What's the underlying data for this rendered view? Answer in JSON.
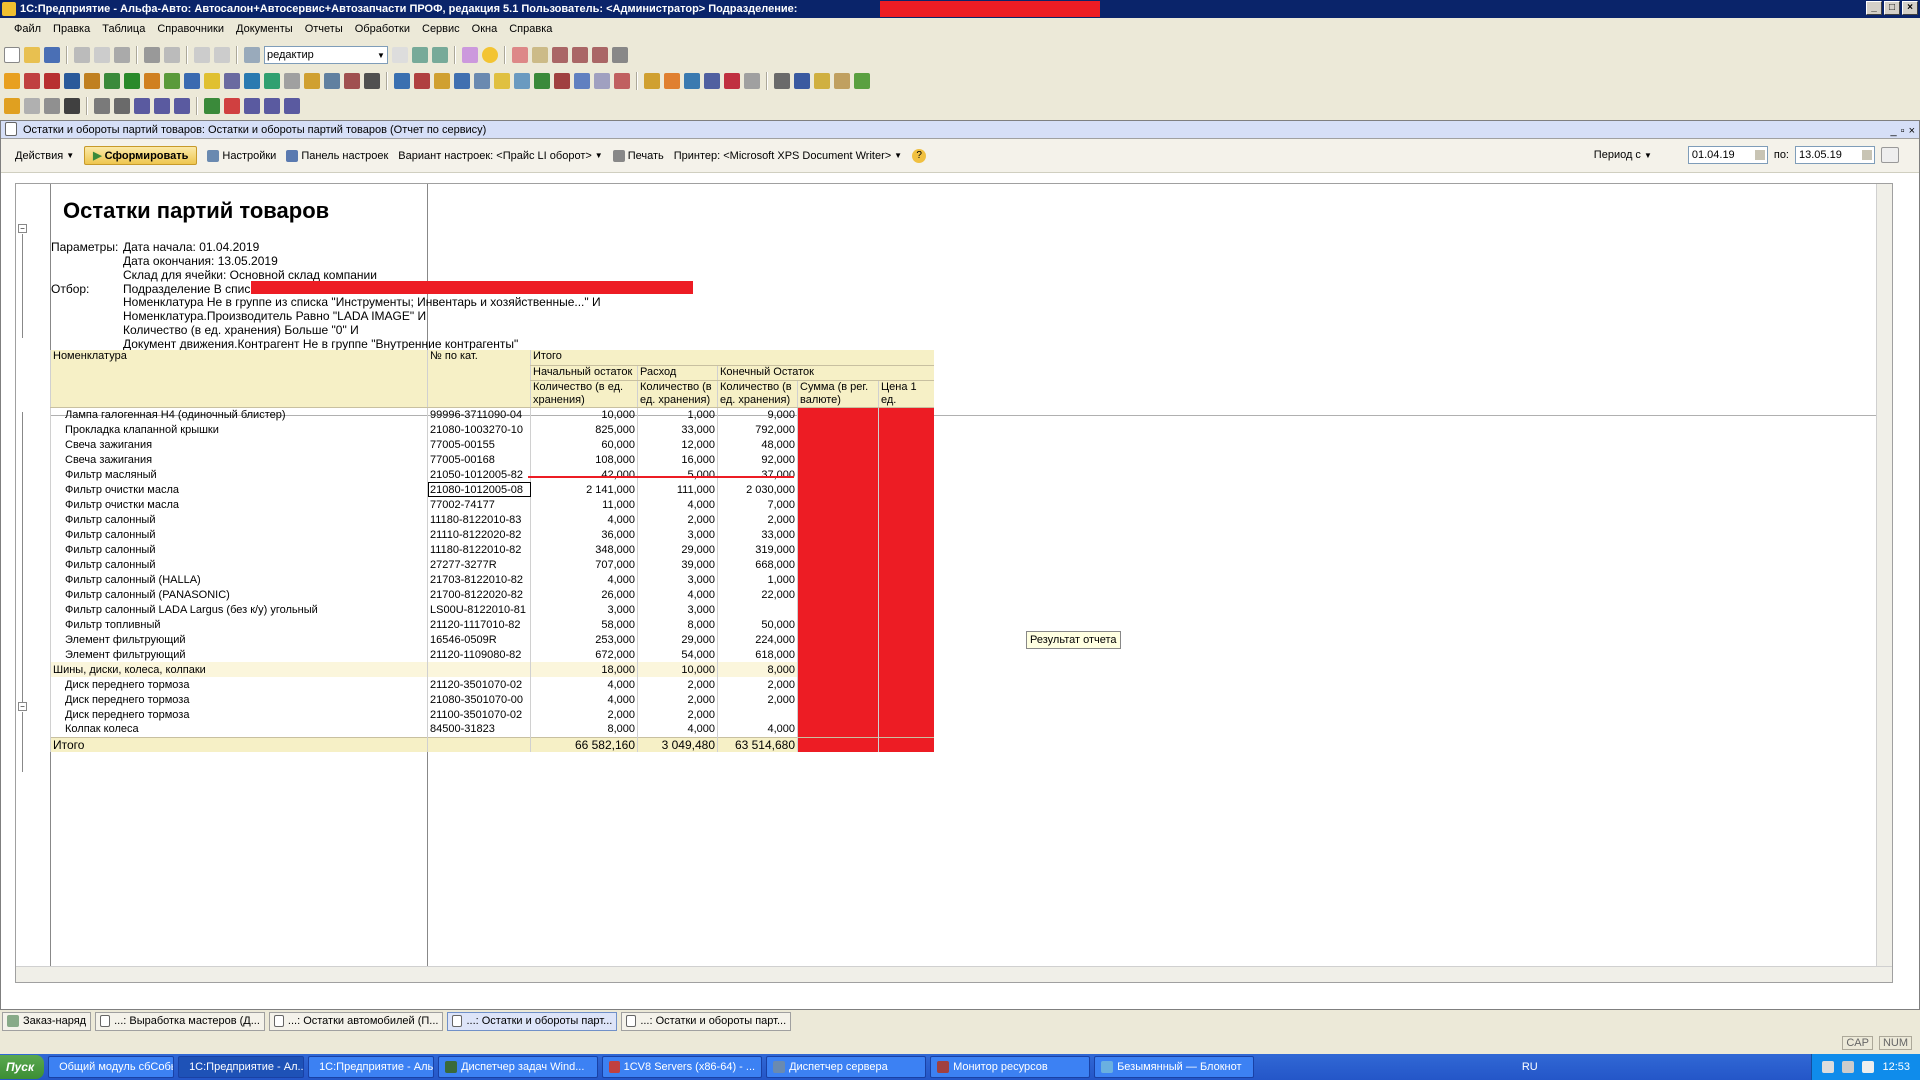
{
  "window": {
    "title": "1С:Предприятие - Альфа-Авто: Автосалон+Автосервис+Автозапчасти ПРОФ, редакция 5.1    Пользователь: <Администратор>    Подразделение:"
  },
  "menu": [
    "Файл",
    "Правка",
    "Таблица",
    "Справочники",
    "Документы",
    "Отчеты",
    "Обработки",
    "Сервис",
    "Окна",
    "Справка"
  ],
  "toolbar": {
    "search_value": "редактир"
  },
  "doc": {
    "title": "Остатки и обороты партий товаров: Остатки и обороты партий товаров (Отчет по сервису)"
  },
  "cmd": {
    "actions": "Действия",
    "generate": "Сформировать",
    "settings": "Настройки",
    "panel": "Панель настроек",
    "variant": "Вариант настроек: <Прайс LI оборот>",
    "print": "Печать",
    "printer": "Принтер: <Microsoft XPS Document Writer>",
    "period": "Период с",
    "date_from": "01.04.19",
    "to_label": "по:",
    "date_to": "13.05.19"
  },
  "report": {
    "title": "Остатки партий товаров",
    "params_label": "Параметры:",
    "params": [
      "Дата начала: 01.04.2019",
      "Дата окончания: 13.05.2019",
      "Склад для ячейки: Основной склад компании"
    ],
    "filter_label": "Отбор:",
    "filters": [
      "Подразделение В списке",
      "Номенклатура Не в группе из списка \"Инструменты; Инвентарь и хозяйственные...\" И",
      "Номенклатура.Производитель Равно \"LADA IMAGE\" И",
      "Количество (в ед. хранения) Больше \"0\" И",
      "Документ движения.Контрагент Не в группе \"Внутренние контрагенты\""
    ],
    "headers": {
      "nomen": "Номенклатура",
      "cat": "№ по кат.",
      "itogo": "Итого",
      "start": "Начальный остаток",
      "rashod": "Расход",
      "end": "Конечный Остаток",
      "qty": "Количество (в ед. хранения)",
      "qty2": "Количество (в ед. хранения)",
      "qty3": "Количество (в ед. хранения)",
      "sum": "Сумма (в рег. валюте)",
      "price": "Цена 1 ед."
    },
    "rows": [
      {
        "name": "Лампа галогенная H4 (одиночный блистер)",
        "cat": "99996-3711090-04",
        "s": "10,000",
        "r": "1,000",
        "e": "9,000"
      },
      {
        "name": "Прокладка клапанной крышки",
        "cat": "21080-1003270-10",
        "s": "825,000",
        "r": "33,000",
        "e": "792,000"
      },
      {
        "name": "Свеча зажигания",
        "cat": "77005-00155",
        "s": "60,000",
        "r": "12,000",
        "e": "48,000"
      },
      {
        "name": "Свеча зажигания",
        "cat": "77005-00168",
        "s": "108,000",
        "r": "16,000",
        "e": "92,000"
      },
      {
        "name": "Фильтр масляный",
        "cat": "21050-1012005-82",
        "s": "42,000",
        "r": "5,000",
        "e": "37,000"
      },
      {
        "name": "Фильтр очистки масла",
        "cat": "21080-1012005-08",
        "s": "2 141,000",
        "r": "111,000",
        "e": "2 030,000"
      },
      {
        "name": "Фильтр очистки масла",
        "cat": "77002-74177",
        "s": "11,000",
        "r": "4,000",
        "e": "7,000"
      },
      {
        "name": "Фильтр салонный",
        "cat": "11180-8122010-83",
        "s": "4,000",
        "r": "2,000",
        "e": "2,000"
      },
      {
        "name": "Фильтр салонный",
        "cat": "21110-8122020-82",
        "s": "36,000",
        "r": "3,000",
        "e": "33,000"
      },
      {
        "name": "Фильтр салонный",
        "cat": "11180-8122010-82",
        "s": "348,000",
        "r": "29,000",
        "e": "319,000"
      },
      {
        "name": "Фильтр салонный",
        "cat": "27277-3277R",
        "s": "707,000",
        "r": "39,000",
        "e": "668,000"
      },
      {
        "name": "Фильтр салонный (HALLA)",
        "cat": "21703-8122010-82",
        "s": "4,000",
        "r": "3,000",
        "e": "1,000"
      },
      {
        "name": "Фильтр салонный (PANASONIC)",
        "cat": "21700-8122020-82",
        "s": "26,000",
        "r": "4,000",
        "e": "22,000"
      },
      {
        "name": "Фильтр салонный LADA Largus (без к/у) угольный",
        "cat": "LS00U-8122010-81",
        "s": "3,000",
        "r": "3,000",
        "e": ""
      },
      {
        "name": "Фильтр топливный",
        "cat": "21120-1117010-82",
        "s": "58,000",
        "r": "8,000",
        "e": "50,000"
      },
      {
        "name": "Элемент фильтрующий",
        "cat": "16546-0509R",
        "s": "253,000",
        "r": "29,000",
        "e": "224,000"
      },
      {
        "name": "Элемент фильтрующий",
        "cat": "21120-1109080-82",
        "s": "672,000",
        "r": "54,000",
        "e": "618,000"
      },
      {
        "name": "Шины, диски, колеса, колпаки",
        "cat": "",
        "s": "18,000",
        "r": "10,000",
        "e": "8,000",
        "group": true
      },
      {
        "name": "Диск переднего тормоза",
        "cat": "21120-3501070-02",
        "s": "4,000",
        "r": "2,000",
        "e": "2,000"
      },
      {
        "name": "Диск переднего тормоза",
        "cat": "21080-3501070-00",
        "s": "4,000",
        "r": "2,000",
        "e": "2,000"
      },
      {
        "name": "Диск переднего тормоза",
        "cat": "21100-3501070-02",
        "s": "2,000",
        "r": "2,000",
        "e": ""
      },
      {
        "name": "Колпак колеса",
        "cat": "84500-31823",
        "s": "8,000",
        "r": "4,000",
        "e": "4,000"
      }
    ],
    "total": {
      "label": "Итого",
      "s": "66 582,160",
      "r": "3 049,480",
      "e": "63 514,680"
    },
    "tooltip": "Результат отчета"
  },
  "open_windows": [
    "Заказ-наряд",
    "...: Выработка мастеров (Д...",
    "...: Остатки автомобилей (П...",
    "...: Остатки и обороты парт...",
    "...: Остатки и обороты парт..."
  ],
  "status": {
    "cap": "CAP",
    "num": "NUM"
  },
  "taskbar": {
    "start": "Пуск",
    "items": [
      "Общий модуль сбСобы...",
      "1С:Предприятие - Ал...",
      "1С:Предприятие - Аль...",
      "Диспетчер задач Wind...",
      "1CV8 Servers (x86-64) - ...",
      "Диспетчер сервера",
      "Монитор ресурсов",
      "Безымянный — Блокнот"
    ],
    "lang": "RU",
    "time": "12:53"
  },
  "colors": {
    "redact": "#ed1c24",
    "title_bg": "#0a246a",
    "header_bg": "#f6f0c6"
  }
}
